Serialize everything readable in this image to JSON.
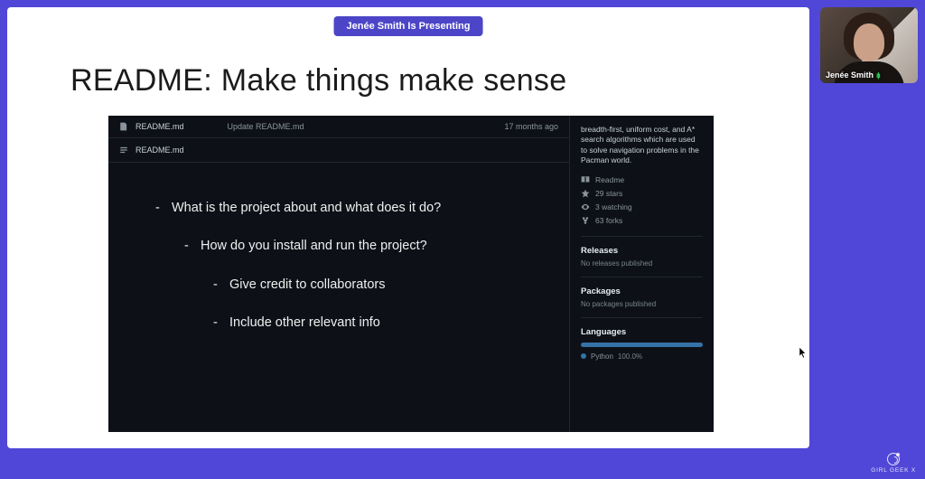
{
  "banner": {
    "text": "Jenée Smith Is Presenting"
  },
  "slide": {
    "title": "README: Make things make sense",
    "github": {
      "file_row": {
        "name": "README.md",
        "commit": "Update README.md",
        "time": "17 months ago"
      },
      "readme_header": "README.md",
      "bullets": [
        {
          "text": "What is the project about and what does it do?",
          "indent": 0
        },
        {
          "text": "How do you install and run the project?",
          "indent": 1
        },
        {
          "text": "Give credit to collaborators",
          "indent": 2
        },
        {
          "text": "Include other relevant info",
          "indent": 2
        }
      ],
      "sidebar": {
        "description": "breadth-first, uniform cost, and A* search algorithms which are used to solve navigation problems in the Pacman world.",
        "meta": {
          "readme": "Readme",
          "stars": "29 stars",
          "watching": "3 watching",
          "forks": "63 forks"
        },
        "releases": {
          "title": "Releases",
          "sub": "No releases published"
        },
        "packages": {
          "title": "Packages",
          "sub": "No packages published"
        },
        "languages": {
          "title": "Languages",
          "name": "Python",
          "pct": "100.0%"
        }
      }
    }
  },
  "camera": {
    "name": "Jenée Smith"
  },
  "brand": {
    "text": "GIRL GEEK X"
  }
}
